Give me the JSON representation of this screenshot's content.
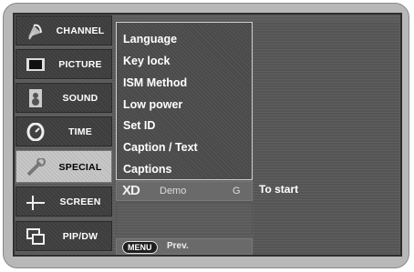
{
  "nav": {
    "items": [
      {
        "label": "CHANNEL",
        "icon": "satellite-dish-icon",
        "active": false
      },
      {
        "label": "PICTURE",
        "icon": "monitor-icon",
        "active": false
      },
      {
        "label": "SOUND",
        "icon": "speaker-icon",
        "active": false
      },
      {
        "label": "TIME",
        "icon": "clock-icon",
        "active": false
      },
      {
        "label": "SPECIAL",
        "icon": "wrench-icon",
        "active": true
      },
      {
        "label": "SCREEN",
        "icon": "crosshair-icon",
        "active": false
      },
      {
        "label": "PIP/DW",
        "icon": "pip-windows-icon",
        "active": false
      }
    ]
  },
  "submenu": {
    "items": [
      "Language",
      "Key lock",
      "ISM Method",
      "Low power",
      "Set ID",
      "Caption / Text",
      "Captions"
    ]
  },
  "xd": {
    "logo": "XD",
    "demo_label": "Demo",
    "key": "G",
    "hint": "To start"
  },
  "footer": {
    "menu_key": "MENU",
    "prev_label": "Prev."
  }
}
